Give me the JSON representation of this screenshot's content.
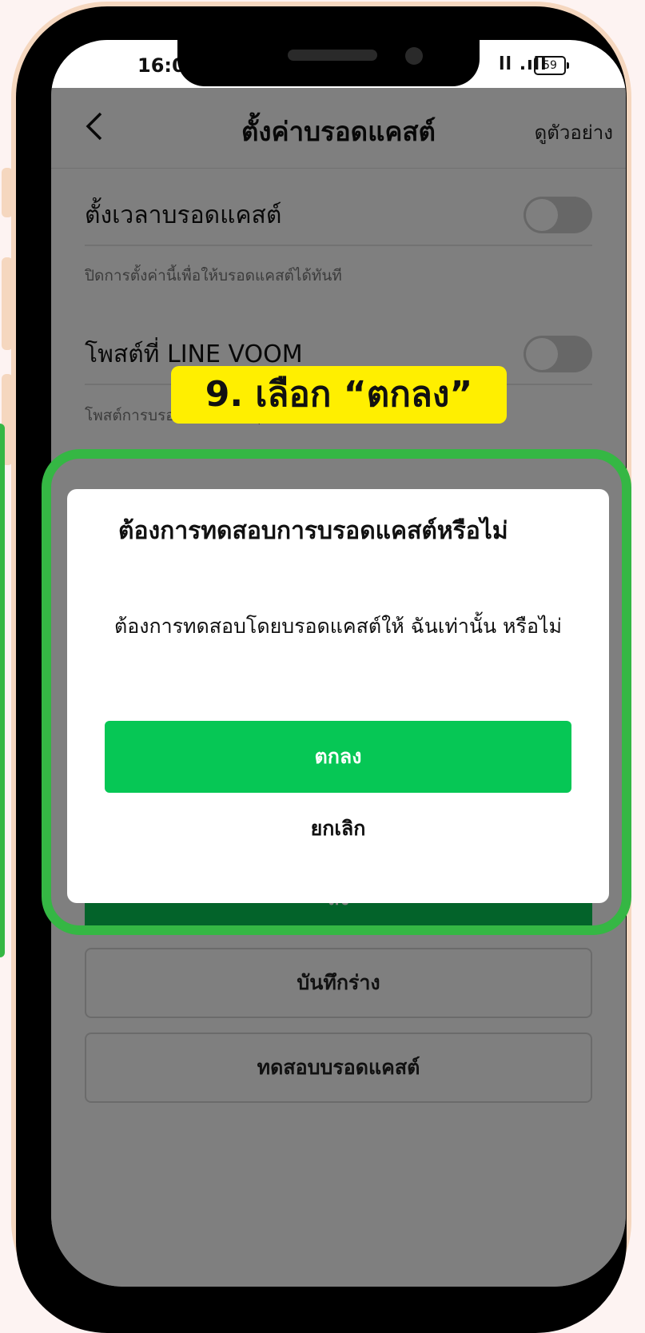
{
  "status_bar": {
    "time": "16:0",
    "signal": "ll .ıll",
    "battery": "59"
  },
  "header": {
    "title": "ตั้งค่าบรอดแคสต์",
    "preview_link": "ดูตัวอย่าง"
  },
  "settings": {
    "schedule": {
      "title": "ตั้งเวลาบรอดแคสต์",
      "description": "ปิดการตั้งค่านี้เพื่อให้บรอดแคสต์ได้ทันที",
      "enabled": false
    },
    "voom": {
      "title": "โพสต์ที่ LINE VOOM",
      "description": "โพสต์การบรอดแคสต์ของคุณที่ LINE VOOM",
      "enabled": false
    }
  },
  "actions": {
    "send": "ส่ง",
    "save_draft": "บันทึกร่าง",
    "test_broadcast": "ทดสอบบรอดแคสต์"
  },
  "dialog": {
    "title": "ต้องการทดสอบการบรอดแคสต์หรือไม่",
    "message": "ต้องการทดสอบโดยบรอดแคสต์ให้ ฉันเท่านั้น หรือไม่",
    "ok_label": "ตกลง",
    "cancel_label": "ยกเลิก"
  },
  "annotation": {
    "step_label": "9. เลือก “ตกลง”"
  },
  "colors": {
    "line_green": "#06c755",
    "highlight_green": "#35b744",
    "label_yellow": "#ffef00",
    "frame_peach": "#f5d7bf"
  }
}
